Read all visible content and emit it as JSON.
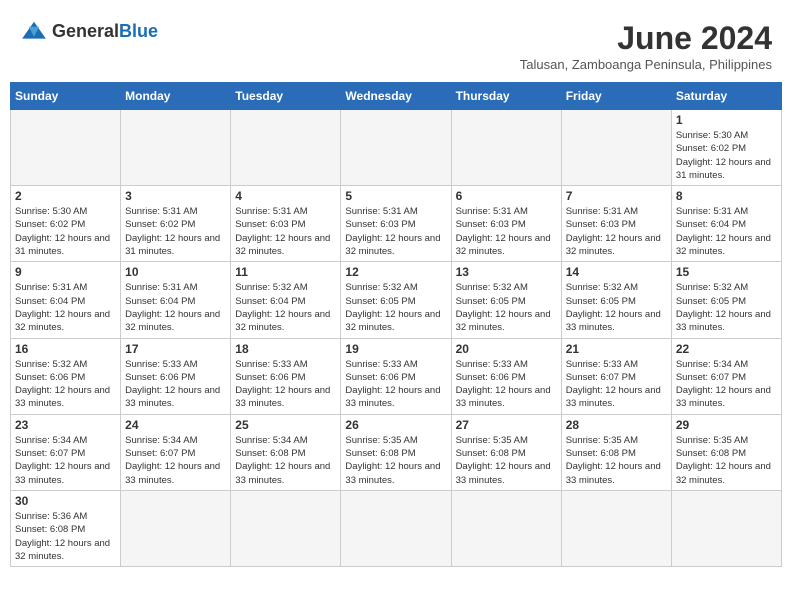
{
  "logo": {
    "text_general": "General",
    "text_blue": "Blue"
  },
  "title": "June 2024",
  "subtitle": "Talusan, Zamboanga Peninsula, Philippines",
  "days_of_week": [
    "Sunday",
    "Monday",
    "Tuesday",
    "Wednesday",
    "Thursday",
    "Friday",
    "Saturday"
  ],
  "weeks": [
    [
      {
        "day": "",
        "empty": true
      },
      {
        "day": "",
        "empty": true
      },
      {
        "day": "",
        "empty": true
      },
      {
        "day": "",
        "empty": true
      },
      {
        "day": "",
        "empty": true
      },
      {
        "day": "",
        "empty": true
      },
      {
        "day": "1",
        "sunrise": "5:30 AM",
        "sunset": "6:02 PM",
        "daylight": "12 hours and 31 minutes."
      }
    ],
    [
      {
        "day": "2",
        "sunrise": "5:30 AM",
        "sunset": "6:02 PM",
        "daylight": "12 hours and 31 minutes."
      },
      {
        "day": "3",
        "sunrise": "5:31 AM",
        "sunset": "6:02 PM",
        "daylight": "12 hours and 31 minutes."
      },
      {
        "day": "4",
        "sunrise": "5:31 AM",
        "sunset": "6:03 PM",
        "daylight": "12 hours and 32 minutes."
      },
      {
        "day": "5",
        "sunrise": "5:31 AM",
        "sunset": "6:03 PM",
        "daylight": "12 hours and 32 minutes."
      },
      {
        "day": "6",
        "sunrise": "5:31 AM",
        "sunset": "6:03 PM",
        "daylight": "12 hours and 32 minutes."
      },
      {
        "day": "7",
        "sunrise": "5:31 AM",
        "sunset": "6:03 PM",
        "daylight": "12 hours and 32 minutes."
      },
      {
        "day": "8",
        "sunrise": "5:31 AM",
        "sunset": "6:04 PM",
        "daylight": "12 hours and 32 minutes."
      }
    ],
    [
      {
        "day": "9",
        "sunrise": "5:31 AM",
        "sunset": "6:04 PM",
        "daylight": "12 hours and 32 minutes."
      },
      {
        "day": "10",
        "sunrise": "5:31 AM",
        "sunset": "6:04 PM",
        "daylight": "12 hours and 32 minutes."
      },
      {
        "day": "11",
        "sunrise": "5:32 AM",
        "sunset": "6:04 PM",
        "daylight": "12 hours and 32 minutes."
      },
      {
        "day": "12",
        "sunrise": "5:32 AM",
        "sunset": "6:05 PM",
        "daylight": "12 hours and 32 minutes."
      },
      {
        "day": "13",
        "sunrise": "5:32 AM",
        "sunset": "6:05 PM",
        "daylight": "12 hours and 32 minutes."
      },
      {
        "day": "14",
        "sunrise": "5:32 AM",
        "sunset": "6:05 PM",
        "daylight": "12 hours and 33 minutes."
      },
      {
        "day": "15",
        "sunrise": "5:32 AM",
        "sunset": "6:05 PM",
        "daylight": "12 hours and 33 minutes."
      }
    ],
    [
      {
        "day": "16",
        "sunrise": "5:32 AM",
        "sunset": "6:06 PM",
        "daylight": "12 hours and 33 minutes."
      },
      {
        "day": "17",
        "sunrise": "5:33 AM",
        "sunset": "6:06 PM",
        "daylight": "12 hours and 33 minutes."
      },
      {
        "day": "18",
        "sunrise": "5:33 AM",
        "sunset": "6:06 PM",
        "daylight": "12 hours and 33 minutes."
      },
      {
        "day": "19",
        "sunrise": "5:33 AM",
        "sunset": "6:06 PM",
        "daylight": "12 hours and 33 minutes."
      },
      {
        "day": "20",
        "sunrise": "5:33 AM",
        "sunset": "6:06 PM",
        "daylight": "12 hours and 33 minutes."
      },
      {
        "day": "21",
        "sunrise": "5:33 AM",
        "sunset": "6:07 PM",
        "daylight": "12 hours and 33 minutes."
      },
      {
        "day": "22",
        "sunrise": "5:34 AM",
        "sunset": "6:07 PM",
        "daylight": "12 hours and 33 minutes."
      }
    ],
    [
      {
        "day": "23",
        "sunrise": "5:34 AM",
        "sunset": "6:07 PM",
        "daylight": "12 hours and 33 minutes."
      },
      {
        "day": "24",
        "sunrise": "5:34 AM",
        "sunset": "6:07 PM",
        "daylight": "12 hours and 33 minutes."
      },
      {
        "day": "25",
        "sunrise": "5:34 AM",
        "sunset": "6:08 PM",
        "daylight": "12 hours and 33 minutes."
      },
      {
        "day": "26",
        "sunrise": "5:35 AM",
        "sunset": "6:08 PM",
        "daylight": "12 hours and 33 minutes."
      },
      {
        "day": "27",
        "sunrise": "5:35 AM",
        "sunset": "6:08 PM",
        "daylight": "12 hours and 33 minutes."
      },
      {
        "day": "28",
        "sunrise": "5:35 AM",
        "sunset": "6:08 PM",
        "daylight": "12 hours and 33 minutes."
      },
      {
        "day": "29",
        "sunrise": "5:35 AM",
        "sunset": "6:08 PM",
        "daylight": "12 hours and 32 minutes."
      }
    ],
    [
      {
        "day": "30",
        "sunrise": "5:36 AM",
        "sunset": "6:08 PM",
        "daylight": "12 hours and 32 minutes."
      },
      {
        "day": "",
        "empty": true
      },
      {
        "day": "",
        "empty": true
      },
      {
        "day": "",
        "empty": true
      },
      {
        "day": "",
        "empty": true
      },
      {
        "day": "",
        "empty": true
      },
      {
        "day": "",
        "empty": true
      }
    ]
  ],
  "labels": {
    "sunrise_prefix": "Sunrise: ",
    "sunset_prefix": "Sunset: ",
    "daylight_prefix": "Daylight: "
  }
}
